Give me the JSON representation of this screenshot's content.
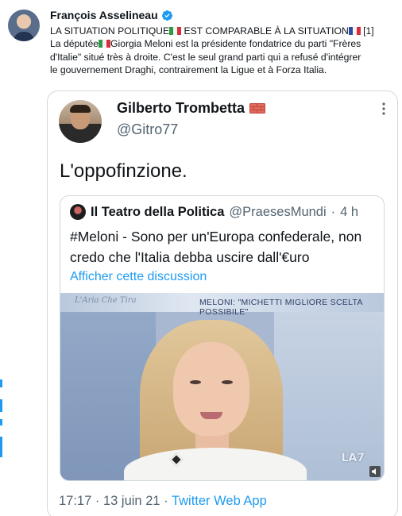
{
  "tweet": {
    "author_name": "François Asselineau",
    "lines": [
      {
        "pre": "LA SITUATION POLITIQUE",
        "flag1": "it",
        "mid": " EST COMPARABLE À LA SITUATION",
        "flag2": "fr",
        "post": " [1]"
      },
      {
        "pre": "La députée",
        "flag1": "it",
        "mid": "Giorgia Meloni est la présidente fondatrice du parti \"Frères",
        "flag2": "",
        "post": ""
      },
      {
        "pre": "d'Italie\" situé très à droite. C'est le seul grand parti qui a refusé d'intégrer",
        "flag1": "",
        "mid": "",
        "flag2": "",
        "post": ""
      },
      {
        "pre": "le gouvernement Draghi, contrairement la Ligue et à Forza Italia.",
        "flag1": "",
        "mid": "",
        "flag2": "",
        "post": ""
      }
    ]
  },
  "quote": {
    "name": "Gilberto Trombetta",
    "handle": "@Gitro77",
    "text": "L'oppofinzione.",
    "inner": {
      "name": "Il Teatro della Politica",
      "handle": "@PraesesMundi",
      "dot": "·",
      "time": "4 h",
      "text_line1": "#Meloni - Sono per un'Europa confederale, non",
      "text_line2": "credo che l'Italia debba uscire dall'€uro",
      "show_thread": "Afficher cette discussion",
      "video": {
        "banner_logo": "L'Aria Che Tira",
        "banner_text": "MELONI: \"MICHETTI MIGLIORE SCELTA POSSIBILE\"",
        "channel": "LA7"
      }
    },
    "meta": {
      "time": "17:17",
      "sep1": "·",
      "date": "13 juin 21",
      "sep2": "·",
      "app": "Twitter Web App"
    }
  },
  "colors": {
    "accent": "#1d9bf0",
    "text": "#0f1419",
    "secondary": "#536471",
    "border": "#cfd9de"
  },
  "icons": [
    "verified-badge-icon",
    "italy-flag-icon",
    "france-flag-icon",
    "brick-icon",
    "more-options-icon",
    "volume-icon"
  ]
}
